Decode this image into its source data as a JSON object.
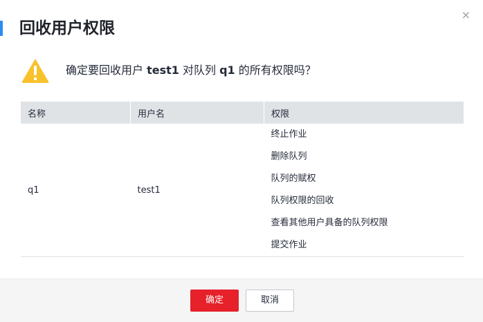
{
  "dialog": {
    "title": "回收用户权限",
    "close_glyph": "×",
    "accent_color": "#2d8cf0",
    "warning_icon": "warning-triangle-icon",
    "warning_color": "#f9c12c",
    "question_prefix": "确定要回收用户 ",
    "question_user": "test1",
    "question_mid": " 对队列 ",
    "question_queue": "q1",
    "question_suffix": " 的所有权限吗？"
  },
  "table": {
    "headers": [
      "名称",
      "用户名",
      "权限"
    ],
    "row": {
      "name": "q1",
      "username": "test1",
      "permissions": [
        "终止作业",
        "删除队列",
        "队列的赋权",
        "队列权限的回收",
        "查看其他用户具备的队列权限",
        "提交作业"
      ]
    }
  },
  "footer": {
    "ok_label": "确定",
    "cancel_label": "取消",
    "ok_color": "#e6212a"
  }
}
